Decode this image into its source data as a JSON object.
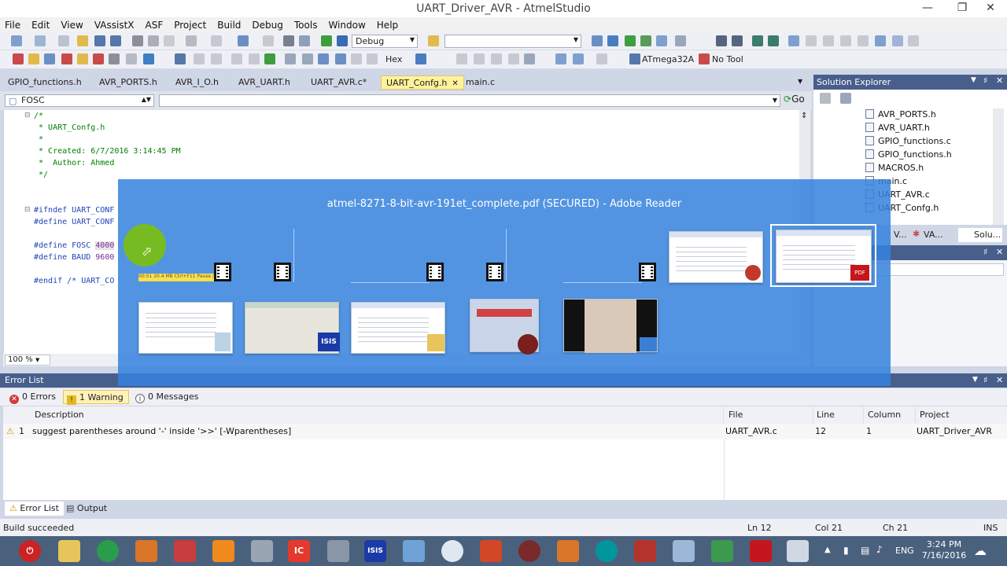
{
  "window": {
    "title": "UART_Driver_AVR - AtmelStudio"
  },
  "menu": [
    "File",
    "Edit",
    "View",
    "VAssistX",
    "ASF",
    "Project",
    "Build",
    "Debug",
    "Tools",
    "Window",
    "Help"
  ],
  "toolbar": {
    "config": "Debug",
    "format": "Hex",
    "device": "ATmega32A",
    "tool": "No Tool"
  },
  "tabs": [
    "GPIO_functions.h",
    "AVR_PORTS.h",
    "AVR_I_O.h",
    "AVR_UART.h",
    "UART_AVR.c*",
    "UART_Confg.h",
    "main.c"
  ],
  "active_tab": "UART_Confg.h",
  "nav": {
    "member": "FOSC",
    "go": "Go"
  },
  "editor": {
    "zoom": "100 %",
    "comment": [
      "/*",
      " * UART_Confg.h",
      " *",
      " * Created: 6/7/2016 3:14:45 PM",
      " *  Author: Ahmed",
      " */"
    ],
    "ifndef": "#ifndef UART_CONF",
    "define1": "#define UART_CONF",
    "fosc_kw": "#define FOSC ",
    "fosc_val": "4000",
    "baud_kw": "#define BAUD ",
    "baud_val": "9600",
    "endif": "#endif /* UART_CO"
  },
  "solution_explorer": {
    "title": "Solution Explorer",
    "items": [
      "AVR_PORTS.h",
      "AVR_UART.h",
      "GPIO_functions.c",
      "GPIO_functions.h",
      "MACROS.h",
      "main.c",
      "UART_AVR.c",
      "UART_Confg.h"
    ],
    "tabs": [
      "V...",
      "VA...",
      "Solu..."
    ]
  },
  "switcher": {
    "title": "atmel-8271-8-bit-avr-191et_complete.pdf (SECURED) - Adobe Reader",
    "strip_text": "00:51   20.4 MB   Ctrl+F11 Pause / Resume",
    "badge_isis": "ISIS",
    "badge_pdf": "PDF"
  },
  "error_list": {
    "title": "Error List",
    "filters": {
      "errors": "0 Errors",
      "warnings": "1 Warning",
      "messages": "0 Messages"
    },
    "columns": [
      "Description",
      "File",
      "Line",
      "Column",
      "Project"
    ],
    "rows": [
      {
        "num": "1",
        "description": "suggest parentheses around '-' inside '>>' [-Wparentheses]",
        "file": "UART_AVR.c",
        "line": "12",
        "column": "1",
        "project": "UART_Driver_AVR"
      }
    ]
  },
  "bottom_tabs": [
    "Error List",
    "Output"
  ],
  "status": {
    "message": "Build succeeded",
    "ln": "Ln 12",
    "col": "Col 21",
    "ch": "Ch 21",
    "mode": "INS"
  },
  "taskbar": {
    "lang": "ENG",
    "time": "3:24 PM",
    "date": "7/16/2016",
    "isis": "ISIS",
    "ic": "IC"
  },
  "colors": {
    "accent": "#485f8c",
    "switcher": "#3682dd",
    "active_tab": "#fff29d",
    "taskbar": "#4a617e"
  }
}
